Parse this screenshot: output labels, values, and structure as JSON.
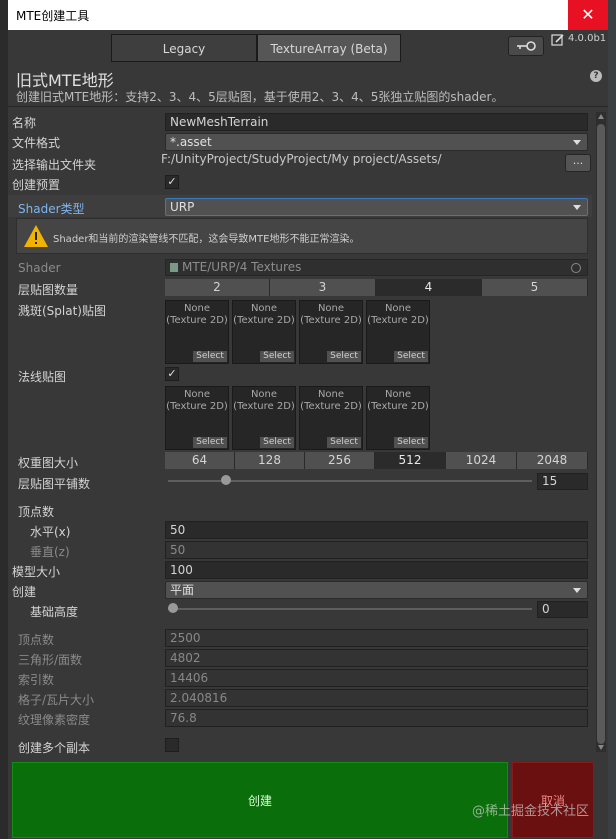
{
  "window": {
    "title": "MTE创建工具",
    "close_glyph": "✕"
  },
  "tabs": [
    {
      "label": "Legacy"
    },
    {
      "label": "TextureArray (Beta)"
    }
  ],
  "version": "4.0.0b1",
  "header": {
    "title": "旧式MTE地形",
    "description": "创建旧式MTE地形：支持2、3、4、5层贴图，基于使用2、3、4、5张独立贴图的shader。",
    "help_glyph": "?"
  },
  "fields": {
    "name": {
      "label": "名称",
      "value": "NewMeshTerrain"
    },
    "file_format": {
      "label": "文件格式",
      "value": "*.asset"
    },
    "output_folder": {
      "label": "选择输出文件夹",
      "value": "F:/UnityProject/StudyProject/My project/Assets/",
      "button": "..."
    },
    "create_prefab": {
      "label": "创建预置",
      "checked": true,
      "check_glyph": "✓"
    },
    "shader_type": {
      "label": "Shader类型",
      "value": "URP"
    },
    "warning": "Shader和当前的渲染管线不匹配，这会导致MTE地形不能正常渲染。",
    "shader": {
      "label": "Shader",
      "value": "MTE/URP/4 Textures"
    },
    "layer_count": {
      "label": "层贴图数量",
      "options": [
        "2",
        "3",
        "4",
        "5"
      ],
      "selected": "4"
    },
    "splat": {
      "label": "溅斑(Splat)贴图",
      "slots": [
        "None\n(Texture 2D)",
        "None\n(Texture 2D)",
        "None\n(Texture 2D)",
        "None\n(Texture 2D)"
      ],
      "select_label": "Select"
    },
    "normal_map": {
      "label": "法线贴图",
      "checked": true,
      "check_glyph": "✓",
      "slots": [
        "None\n(Texture 2D)",
        "None\n(Texture 2D)",
        "None\n(Texture 2D)",
        "None\n(Texture 2D)"
      ],
      "select_label": "Select"
    },
    "weight_size": {
      "label": "权重图大小",
      "options": [
        "64",
        "128",
        "256",
        "512",
        "1024",
        "2048"
      ],
      "selected": "512"
    },
    "tiling": {
      "label": "层贴图平铺数",
      "value": "15",
      "fraction": 0.15
    },
    "vertex_count": {
      "label": "顶点数"
    },
    "horizontal": {
      "label": "水平(x)",
      "value": "50"
    },
    "vertical": {
      "label": "垂直(z)",
      "value": "50"
    },
    "model_size": {
      "label": "模型大小",
      "value": "100"
    },
    "create": {
      "label": "创建",
      "value": "平面"
    },
    "base_height": {
      "label": "基础高度",
      "value": "0",
      "fraction": 0.0
    }
  },
  "stats": [
    {
      "label": "顶点数",
      "value": "2500"
    },
    {
      "label": "三角形/面数",
      "value": "4802"
    },
    {
      "label": "索引数",
      "value": "14406"
    },
    {
      "label": "格子/瓦片大小",
      "value": "2.040816"
    },
    {
      "label": "纹理像素密度",
      "value": "76.8"
    }
  ],
  "multi_copy": {
    "label": "创建多个副本",
    "checked": false
  },
  "buttons": {
    "create": "创建",
    "cancel": "取消"
  },
  "watermark": "@稀土掘金技术社区"
}
